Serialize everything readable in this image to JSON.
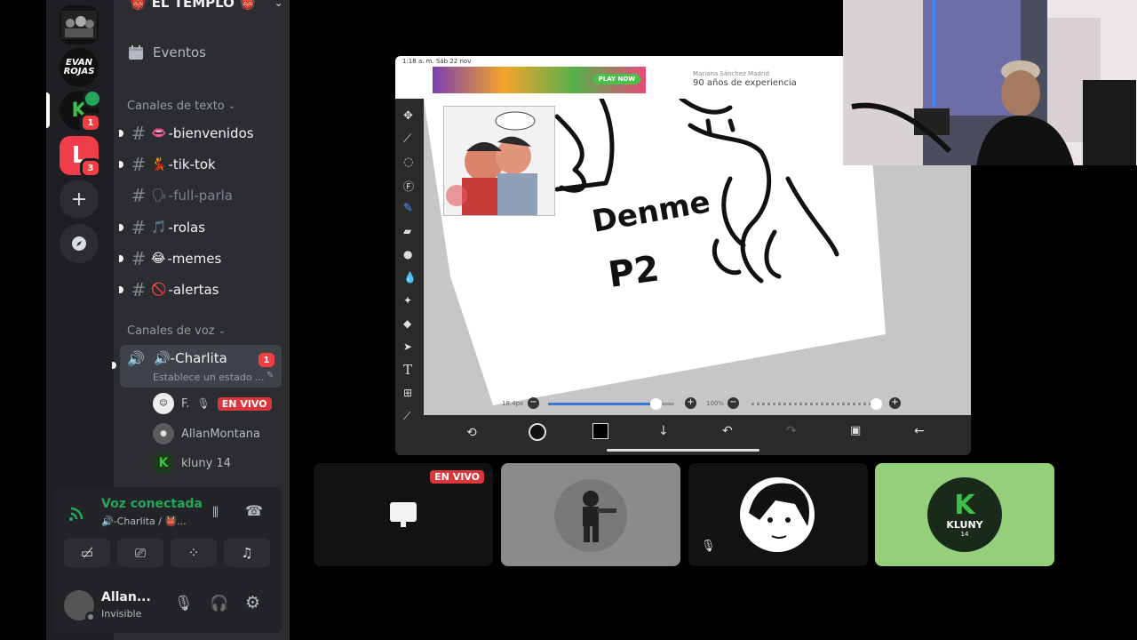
{
  "server": {
    "name": "EL TEMPLO",
    "emoji": "👹"
  },
  "rail": {
    "servers": [
      {
        "label": "",
        "badge": ""
      },
      {
        "label": "EVAN ROJAS",
        "badge": ""
      },
      {
        "label": "K",
        "badge": "1"
      },
      {
        "label": "L",
        "badge": "3"
      }
    ]
  },
  "sidebar": {
    "events_label": "Eventos",
    "text_category": "Canales de texto",
    "text_channels": [
      {
        "emoji": "👄",
        "name": "-bienvenidos"
      },
      {
        "emoji": "💃",
        "name": "-tik-tok"
      },
      {
        "emoji": "🗣",
        "name": "-full-parla"
      },
      {
        "emoji": "🎵",
        "name": "-rolas"
      },
      {
        "emoji": "😂",
        "name": "-memes"
      },
      {
        "emoji": "🚫",
        "name": "-alertas"
      }
    ],
    "voice_category": "Canales de voz",
    "voice_channel": {
      "name": "🔊-Charlita",
      "badge": "1",
      "status_placeholder": "Establece un estado ..."
    },
    "voice_users": [
      {
        "name": "F.",
        "live": "EN VIVO"
      },
      {
        "name": "AllanMontana"
      },
      {
        "name": "kluny 14"
      }
    ]
  },
  "panel": {
    "voice_status": "Voz conectada",
    "voice_location": "🔊-Charlita / 👹...",
    "user_name": "Allan...",
    "user_status": "Invisible"
  },
  "stream": {
    "status_time": "1:18 a. m.  Sáb 22 nov",
    "ad_button": "PLAY NOW",
    "ad_promo_name": "Mariana Sánchez Madrid",
    "ad_promo_text": "90 años de experiencia",
    "canvas_text_line1": "Denme",
    "canvas_text_line2": "P2",
    "brush_size": "18.4px",
    "opacity": "100%",
    "brush_fill": 0.85,
    "opacity_fill": 0.95
  },
  "tiles": [
    {
      "name": "screen-share",
      "live": "EN VIVO"
    },
    {
      "name": "AllanMontana"
    },
    {
      "name": "F."
    },
    {
      "name": "kluny 14",
      "logo_text": "KLUNY",
      "logo_sub": "14"
    }
  ],
  "colors": {
    "discord_red": "#da373c",
    "voice_green": "#23a55a",
    "kluny_green": "#96cf7c",
    "brush_blue": "#3a78d8"
  }
}
